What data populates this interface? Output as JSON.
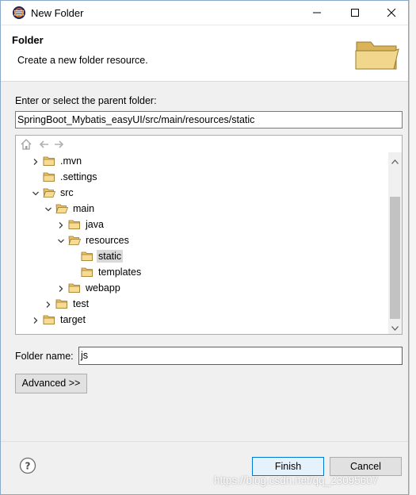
{
  "window": {
    "title": "New Folder"
  },
  "header": {
    "title": "Folder",
    "description": "Create a new folder resource."
  },
  "parent": {
    "label": "Enter or select the parent folder:",
    "value": "SpringBoot_Mybatis_easyUI/src/main/resources/static"
  },
  "tree": {
    "items": [
      {
        "label": ".mvn",
        "expanded": false,
        "has_children": true,
        "selected": false
      },
      {
        "label": ".settings",
        "expanded": false,
        "has_children": false,
        "selected": false
      },
      {
        "label": "src",
        "expanded": true,
        "has_children": true,
        "selected": false
      },
      {
        "label": "main",
        "expanded": true,
        "has_children": true,
        "selected": false
      },
      {
        "label": "java",
        "expanded": false,
        "has_children": true,
        "selected": false
      },
      {
        "label": "resources",
        "expanded": true,
        "has_children": true,
        "selected": false
      },
      {
        "label": "static",
        "expanded": false,
        "has_children": false,
        "selected": true
      },
      {
        "label": "templates",
        "expanded": false,
        "has_children": false,
        "selected": false
      },
      {
        "label": "webapp",
        "expanded": false,
        "has_children": true,
        "selected": false
      },
      {
        "label": "test",
        "expanded": false,
        "has_children": true,
        "selected": false
      },
      {
        "label": "target",
        "expanded": false,
        "has_children": true,
        "selected": false
      }
    ]
  },
  "folder_name": {
    "label": "Folder name:",
    "value": "js"
  },
  "buttons": {
    "advanced": "Advanced >>",
    "finish": "Finish",
    "cancel": "Cancel"
  },
  "watermark": "https://blog.csdn.net/qq_23095607",
  "colors": {
    "folder": "#e8c16a",
    "selection": "#d9d9d9",
    "default_button_border": "#0078d7"
  }
}
